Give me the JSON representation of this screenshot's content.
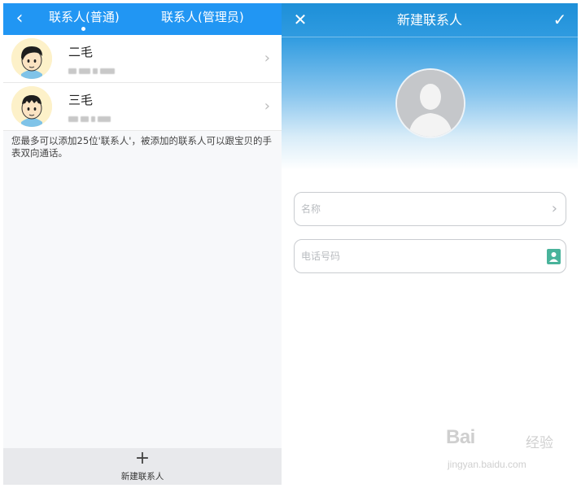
{
  "left_screen": {
    "header": {
      "back_icon": "chevron-left-icon",
      "tabs": [
        {
          "label": "联系人(普通)",
          "active": true
        },
        {
          "label": "联系人(管理员)",
          "active": false
        }
      ]
    },
    "contacts": [
      {
        "name": "二毛",
        "avatar": "cartoon-boy-avatar",
        "phone": "blurred"
      },
      {
        "name": "三毛",
        "avatar": "cartoon-boy-avatar",
        "phone": "blurred"
      }
    ],
    "notice": "您最多可以添加25位'联系人'，被添加的联系人可以跟宝贝的手表双向通话。",
    "bottom_bar": {
      "icon": "plus-icon",
      "label": "新建联系人"
    }
  },
  "right_screen": {
    "header": {
      "close_icon": "close-icon",
      "title": "新建联系人",
      "confirm_icon": "check-icon"
    },
    "photo": "default-avatar-placeholder",
    "fields": {
      "name": {
        "placeholder": "名称",
        "value": ""
      },
      "phone": {
        "placeholder": "电话号码",
        "value": ""
      }
    }
  },
  "watermark": {
    "logo_text": "Bai",
    "logo_text_2": "经验",
    "url": "jingyan.baidu.com"
  },
  "colors": {
    "header_blue": "#2196f3",
    "gradient_blue": "#1d8fd8",
    "contact_book_icon": "#49b39b"
  }
}
